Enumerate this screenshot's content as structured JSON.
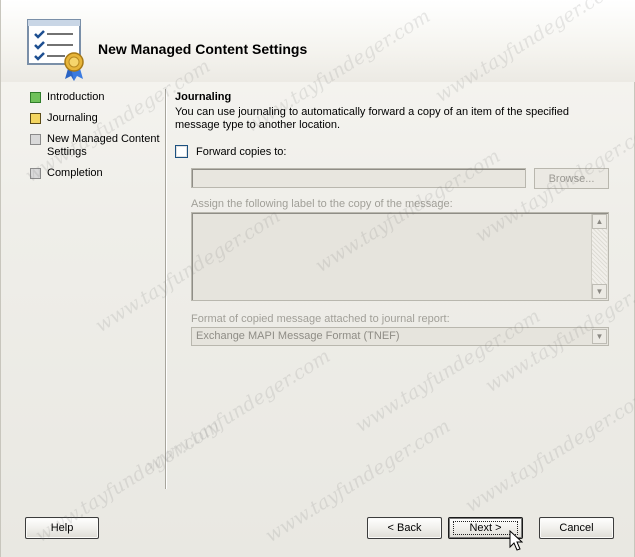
{
  "wizard": {
    "title": "New Managed Content Settings"
  },
  "nav": {
    "items": [
      {
        "label": "Introduction",
        "state": "complete"
      },
      {
        "label": "Journaling",
        "state": "current"
      },
      {
        "label": "New Managed Content Settings",
        "state": "pending"
      },
      {
        "label": "Completion",
        "state": "pending"
      }
    ]
  },
  "journaling": {
    "heading": "Journaling",
    "description": "You can use journaling to automatically forward a copy of an item of the specified message type to another location.",
    "forward_label": "Forward copies to:",
    "forward_checked": false,
    "forward_value": "",
    "browse_label": "Browse...",
    "label_prompt": "Assign the following label to the copy of the message:",
    "label_value": "",
    "format_prompt": "Format of copied message attached to journal report:",
    "format_selected": "Exchange MAPI Message Format (TNEF)"
  },
  "buttons": {
    "help": "Help",
    "back": "< Back",
    "next": "Next >",
    "cancel": "Cancel"
  },
  "watermark": "www.tayfundeger.com",
  "colors": {
    "complete": "#6fc15a",
    "current": "#f3d560",
    "pending": "#d9d9d9"
  }
}
